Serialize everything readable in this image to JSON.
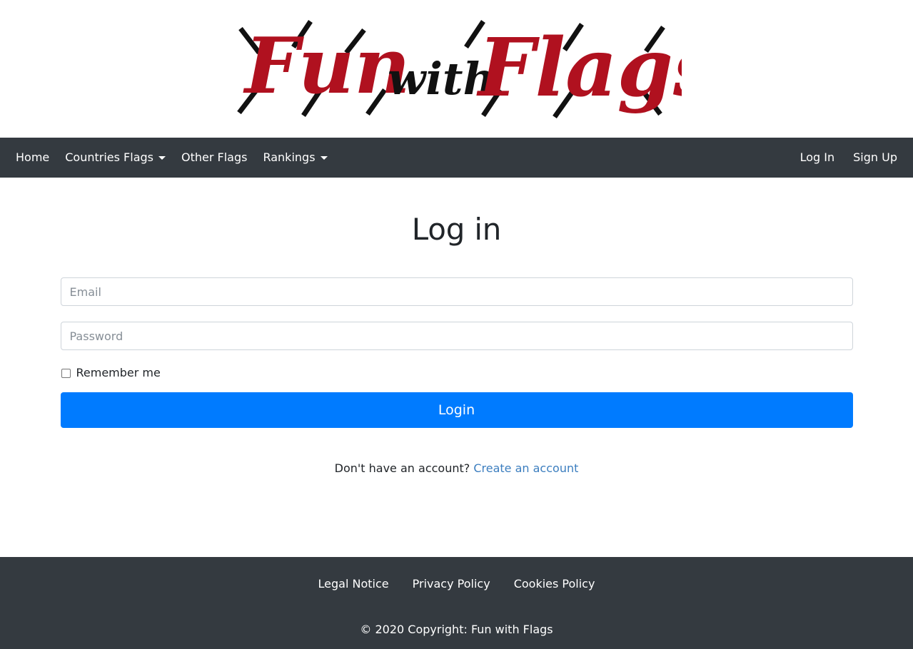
{
  "brand": {
    "logo_word_1": "Fun",
    "logo_word_2": "with",
    "logo_word_3": "Flags",
    "logo_alt": "Fun with Flags",
    "red": "#b0111f",
    "black": "#111111"
  },
  "navbar": {
    "background": "#343a40",
    "items": [
      {
        "label": "Home",
        "has_caret": false
      },
      {
        "label": "Countries Flags",
        "has_caret": true
      },
      {
        "label": "Other Flags",
        "has_caret": false
      },
      {
        "label": "Rankings",
        "has_caret": true
      }
    ],
    "right_items": [
      {
        "label": "Log In"
      },
      {
        "label": "Sign Up"
      }
    ]
  },
  "main": {
    "title": "Log in",
    "email": {
      "value": "",
      "placeholder": "Email"
    },
    "password": {
      "value": "",
      "placeholder": "Password"
    },
    "remember": {
      "label": "Remember me",
      "checked": false
    },
    "login_button": "Login",
    "signup_prompt": "Don't have an account?",
    "signup_link": "Create an account",
    "accent": "#007bff",
    "link_color": "#3c7ebf"
  },
  "footer": {
    "background": "#343a40",
    "links": [
      "Legal Notice",
      "Privacy Policy",
      "Cookies Policy"
    ],
    "copyright": "© 2020 Copyright: Fun with Flags"
  }
}
